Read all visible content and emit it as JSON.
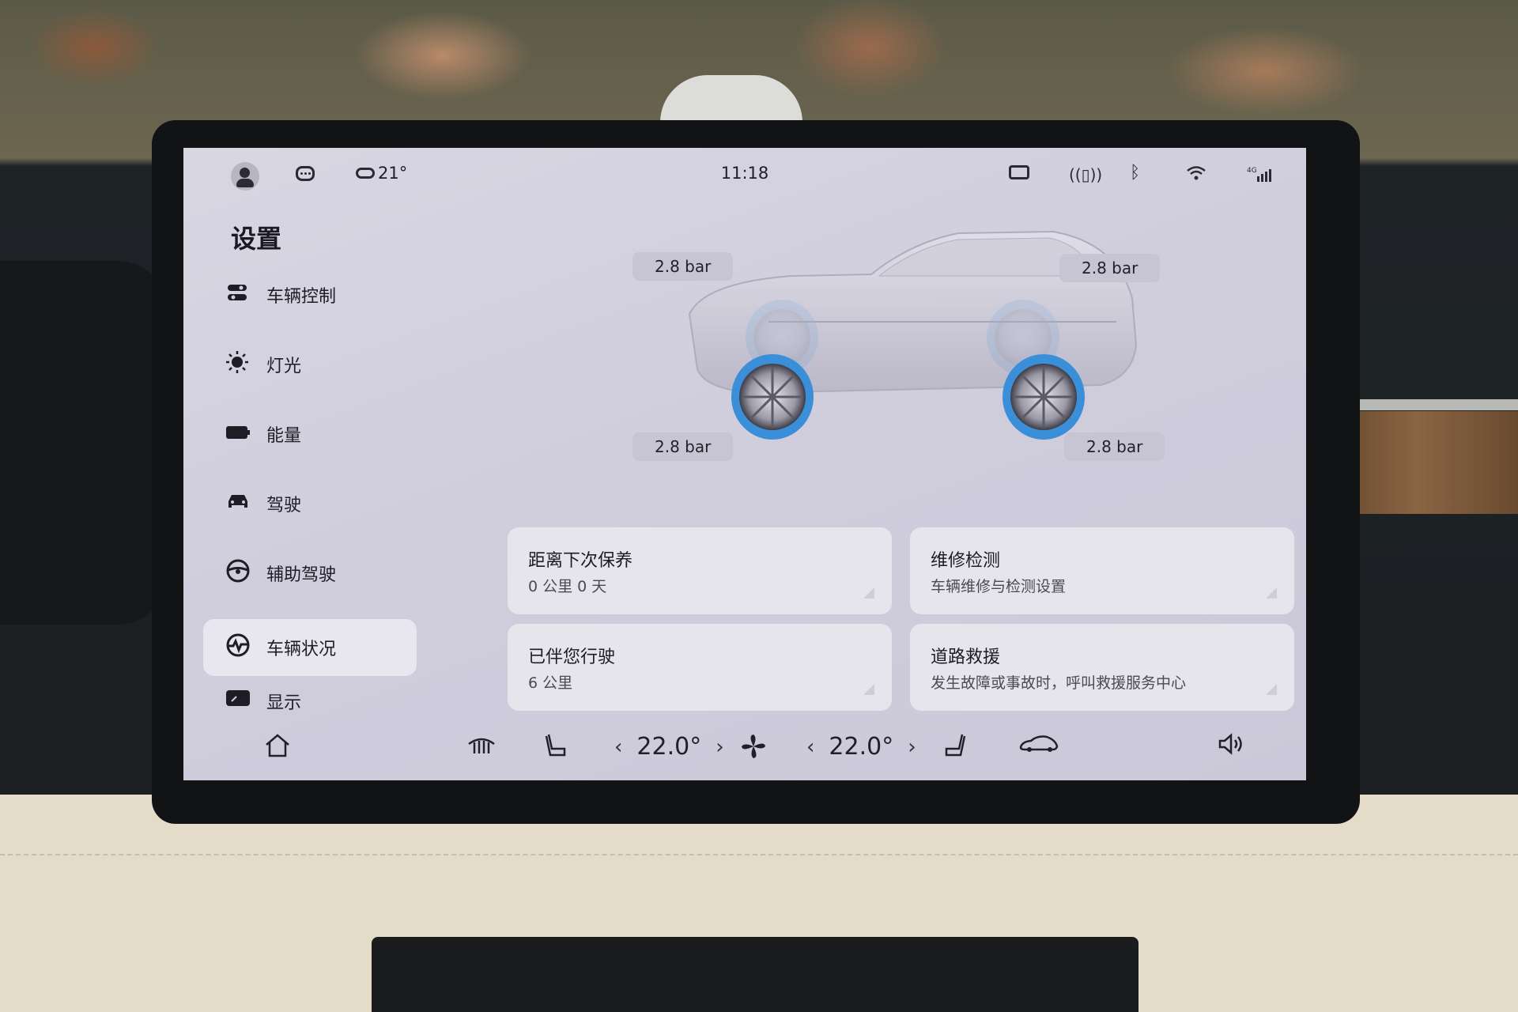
{
  "status_bar": {
    "weather_temp": "21°",
    "time": "11:18"
  },
  "settings": {
    "title": "设置",
    "nav": [
      {
        "label": "车辆控制",
        "icon": "vehicle-control-icon"
      },
      {
        "label": "灯光",
        "icon": "light-icon"
      },
      {
        "label": "能量",
        "icon": "battery-icon"
      },
      {
        "label": "驾驶",
        "icon": "car-icon"
      },
      {
        "label": "辅助驾驶",
        "icon": "steering-wheel-icon"
      },
      {
        "label": "车辆状况",
        "icon": "vehicle-status-icon",
        "active": true
      },
      {
        "label": "显示",
        "icon": "display-icon"
      }
    ]
  },
  "tires": {
    "front_left": "2.8 bar",
    "rear_left": "2.8 bar",
    "front_right": "2.8 bar",
    "rear_right": "2.8 bar"
  },
  "cards": [
    {
      "title": "距离下次保养",
      "subtitle": "0 公里 0 天"
    },
    {
      "title": "维修检测",
      "subtitle": "车辆维修与检测设置"
    },
    {
      "title": "已伴您行驶",
      "subtitle": "6 公里"
    },
    {
      "title": "道路救援",
      "subtitle": "发生故障或事故时，呼叫救援服务中心"
    }
  ],
  "climate": {
    "driver_temp": "22.0°",
    "passenger_temp": "22.0°"
  },
  "colors": {
    "screen_bg": "#d0cedd",
    "card_bg": "#e6e5ec",
    "tire_highlight": "#3a8fd8"
  }
}
